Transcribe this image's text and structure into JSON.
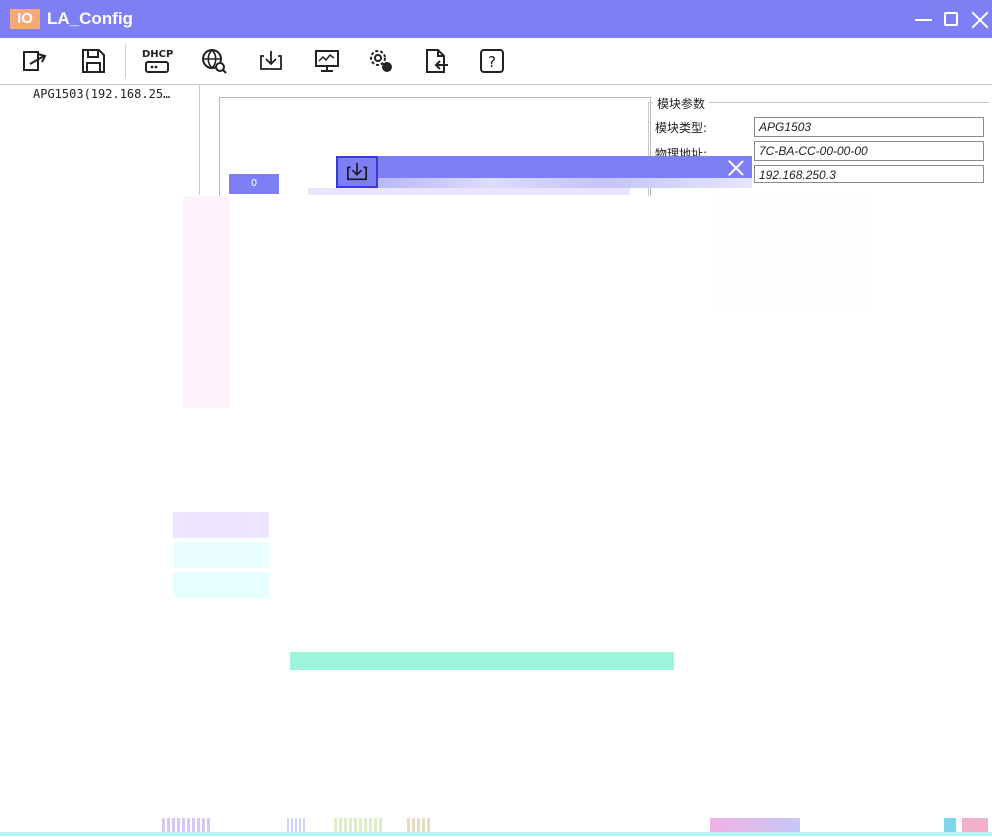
{
  "window": {
    "logo": "IO",
    "title": "LA_Config"
  },
  "toolbar": {
    "dhcp_label": "DHCP",
    "help_label": "?"
  },
  "tree": {
    "items": [
      {
        "label": "APG1503(192.168.25…"
      }
    ]
  },
  "main": {
    "led_value": "0"
  },
  "module_params": {
    "title": "模块参数",
    "rows": [
      {
        "label": "模块类型:",
        "value": "APG1503"
      },
      {
        "label": "物理地址:",
        "value": "7C-BA-CC-00-00-00"
      },
      {
        "label": "",
        "value": "192.168.250.3"
      }
    ]
  },
  "dialog": {
    "icon": "download-icon"
  },
  "colors": {
    "titlebar": "#7f7ff5",
    "logo_bg": "#f7a97a",
    "progress_track": "#9ff5dc"
  }
}
